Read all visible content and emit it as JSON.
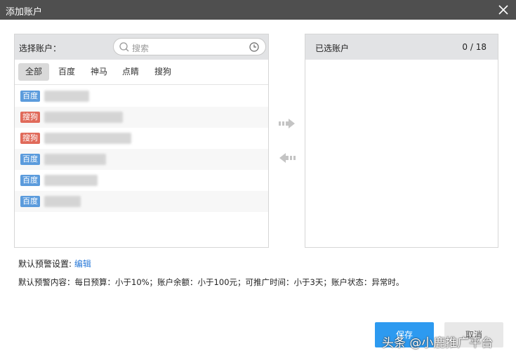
{
  "window": {
    "title": "添加账户"
  },
  "left_panel": {
    "label": "选择账户：",
    "search_placeholder": "搜索",
    "tabs": [
      "全部",
      "百度",
      "神马",
      "点睛",
      "搜狗"
    ],
    "accounts": [
      {
        "platform": "百度",
        "kind": "baidu"
      },
      {
        "platform": "搜狗",
        "kind": "sogou"
      },
      {
        "platform": "搜狗",
        "kind": "sogou"
      },
      {
        "platform": "百度",
        "kind": "baidu"
      },
      {
        "platform": "百度",
        "kind": "baidu"
      },
      {
        "platform": "百度",
        "kind": "baidu"
      }
    ]
  },
  "right_panel": {
    "label": "已选账户",
    "count": "0 / 18"
  },
  "default_setting": {
    "label": "默认预警设置:",
    "edit": "编辑"
  },
  "default_content": "默认预警内容：每日预算：小于10%；账户余额：小于100元；可推广时间：小于3天；账户状态：异常时。",
  "buttons": {
    "save": "保存",
    "cancel": "取消"
  },
  "watermark": "头条 @小鹿推广平台",
  "colors": {
    "primary": "#2d9af0",
    "baidu_tag": "#5b9bdc",
    "sogou_tag": "#e06a5a",
    "titlebar": "#4f4f4f"
  }
}
